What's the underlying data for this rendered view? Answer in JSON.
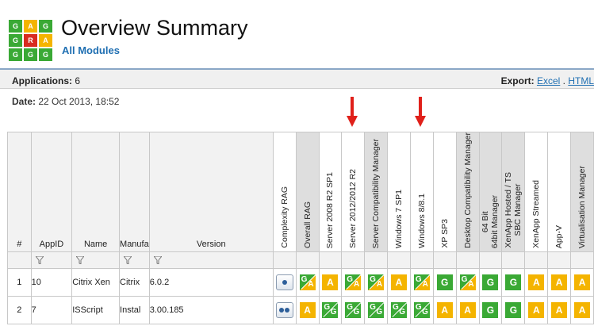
{
  "logo": {
    "cells": [
      "G",
      "A",
      "G",
      "G",
      "R",
      "A",
      "G",
      "G",
      "G"
    ]
  },
  "header": {
    "title": "Overview Summary",
    "subtitle": "All Modules"
  },
  "toolbar": {
    "applications_label": "Applications:",
    "applications_count": "6",
    "export_label": "Export:",
    "export_excel": "Excel",
    "export_sep": ".",
    "export_html": "HTML"
  },
  "report": {
    "date_label": "Date:",
    "date_value": "22 Oct 2013, 18:52"
  },
  "columns": {
    "num": "#",
    "appid": "AppID",
    "name": "Name",
    "manufacturer": "Manufa",
    "version": "Version",
    "complexity": "Complexity RAG",
    "overall": "Overall RAG",
    "srv2008": "Server 2008 R2 SP1",
    "srv2012": "Server 2012/2012 R2",
    "srvcompat": "Server Compatibility Manager",
    "win7": "Windows 7 SP1",
    "win8": "Windows 8/8.1",
    "xp": "XP SP3",
    "deskcompat": "Desktop Compatibility Manager",
    "bit64_l1": "64 Bit",
    "bit64_l2": "64bit Manager",
    "xenapp_l1": "XenApp Hosted / TS",
    "xenapp_l2": "SBC Manager",
    "xenstream": "XenApp Streamed",
    "appv": "App-V",
    "virt": "Virtualisation Manager"
  },
  "rows": [
    {
      "num": "1",
      "appid": "10",
      "name": "Citrix Xen",
      "manufacturer": "Citrix",
      "version": "6.0.2",
      "complexity_dots": 1,
      "rag": [
        "GA",
        "A",
        "GA",
        "GA",
        "A",
        "GA",
        "G",
        "GA",
        "G",
        "G",
        "A",
        "A",
        "A"
      ]
    },
    {
      "num": "2",
      "appid": "7",
      "name": "ISScript",
      "manufacturer": "Instal",
      "version": "3.00.185",
      "complexity_dots": 2,
      "rag": [
        "A",
        "GG",
        "GG",
        "GG",
        "GG",
        "GG",
        "A",
        "A",
        "G",
        "G",
        "A",
        "A",
        "A"
      ]
    }
  ],
  "colors": {
    "green": "#3aa935",
    "amber": "#f4b400",
    "red": "#d92b20",
    "link": "#1f6fb2",
    "arrow": "#e0201a"
  }
}
